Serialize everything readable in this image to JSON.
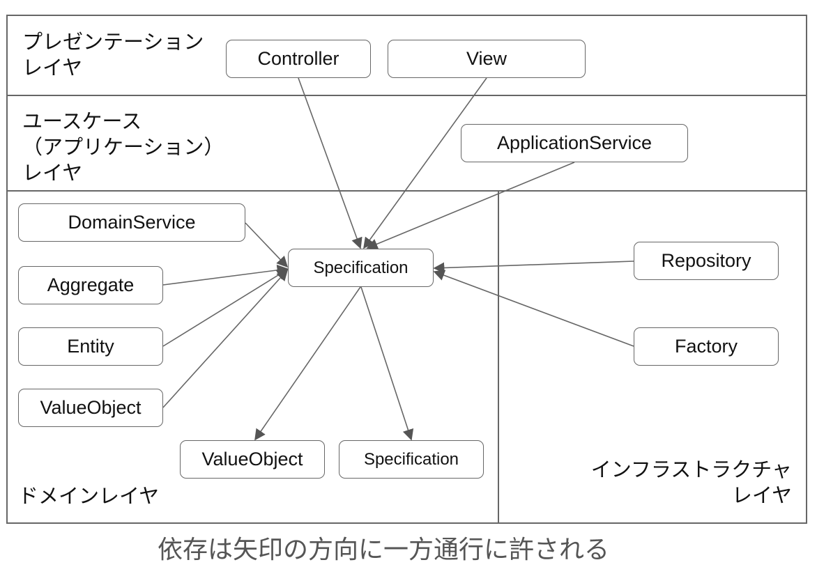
{
  "layers": {
    "presentation": "プレゼンテーション\nレイヤ",
    "usecase": "ユースケース\n（アプリケーション）\nレイヤ",
    "domain": "ドメインレイヤ",
    "infrastructure": "インフラストラクチャ\nレイヤ"
  },
  "nodes": {
    "controller": "Controller",
    "view": "View",
    "application_service": "ApplicationService",
    "domain_service": "DomainService",
    "aggregate": "Aggregate",
    "entity": "Entity",
    "value_object_left": "ValueObject",
    "specification_center": "Specification",
    "value_object_bottom": "ValueObject",
    "specification_bottom": "Specification",
    "repository": "Repository",
    "factory": "Factory"
  },
  "edges": [
    {
      "from": "controller",
      "to": "specification_center"
    },
    {
      "from": "view",
      "to": "specification_center"
    },
    {
      "from": "application_service",
      "to": "specification_center"
    },
    {
      "from": "domain_service",
      "to": "specification_center"
    },
    {
      "from": "aggregate",
      "to": "specification_center"
    },
    {
      "from": "entity",
      "to": "specification_center"
    },
    {
      "from": "value_object_left",
      "to": "specification_center"
    },
    {
      "from": "repository",
      "to": "specification_center"
    },
    {
      "from": "factory",
      "to": "specification_center"
    },
    {
      "from": "specification_center",
      "to": "value_object_bottom"
    },
    {
      "from": "specification_center",
      "to": "specification_bottom"
    }
  ],
  "caption": "依存は矢印の方向に一方通行に許される",
  "colors": {
    "line": "#666666",
    "arrow": "#555555",
    "caption": "#555555"
  }
}
